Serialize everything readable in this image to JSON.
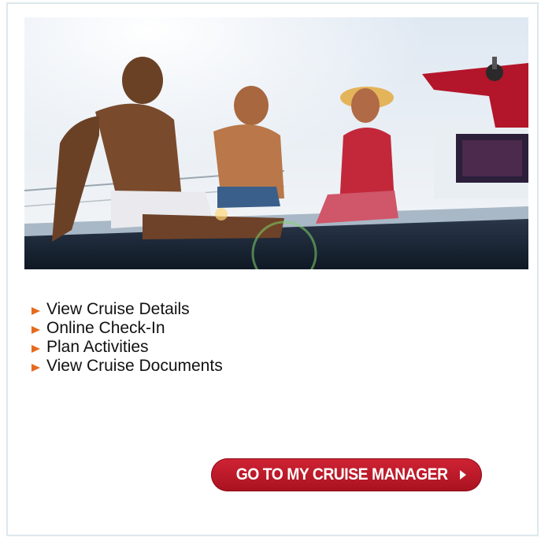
{
  "links": [
    {
      "label": "View Cruise Details"
    },
    {
      "label": "Online Check-In"
    },
    {
      "label": "Plan Activities"
    },
    {
      "label": "View Cruise Documents"
    }
  ],
  "cta": {
    "label": "GO TO MY CRUISE MANAGER"
  },
  "icons": {
    "bullet": "orange-triangle-bullet-icon",
    "cta_arrow": "chevron-right-icon"
  },
  "colors": {
    "bullet": "#e66a1e",
    "cta_background": "#c01c2c",
    "cta_text": "#ffffff",
    "panel_border": "#dde8ee"
  }
}
